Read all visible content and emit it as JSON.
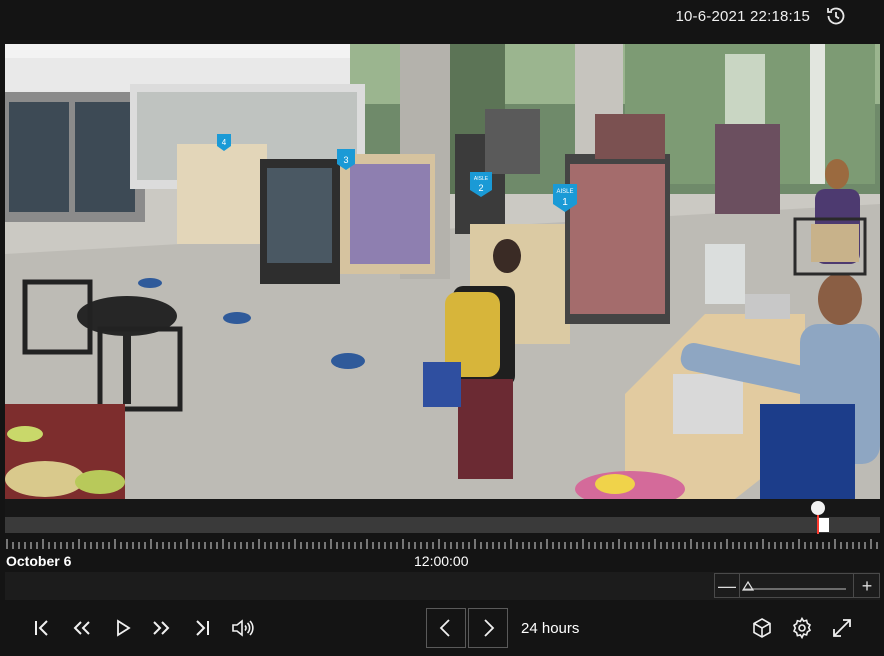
{
  "header": {
    "timestamp": "10-6-2021 22:18:15",
    "history_icon": "history-clock-icon"
  },
  "video": {
    "description_icon": "camera-feed",
    "aisle_signs": [
      {
        "top": "AISLE",
        "number": "1"
      },
      {
        "top": "AISLE",
        "number": "2"
      },
      {
        "top": "",
        "number": "3"
      },
      {
        "top": "",
        "number": "4"
      }
    ]
  },
  "timeline": {
    "date_label": "October 6",
    "center_time_label": "12:00:00",
    "playhead_color": "#ff3b30"
  },
  "zoom": {
    "minus_label": "—",
    "plus_label": "+",
    "icons": [
      "zoom-out-icon",
      "zoom-slider-icon",
      "zoom-in-icon"
    ]
  },
  "controls": {
    "range_label": "24 hours",
    "icons": [
      "skip-to-start-icon",
      "rewind-icon",
      "play-icon",
      "fast-forward-icon",
      "skip-to-end-icon",
      "volume-icon",
      "previous-icon",
      "next-icon",
      "3d-cube-icon",
      "settings-gear-icon",
      "fullscreen-icon"
    ]
  },
  "colors": {
    "background": "#141414",
    "track": "#3a3a3a",
    "accent_sign": "#1a9ad6"
  }
}
